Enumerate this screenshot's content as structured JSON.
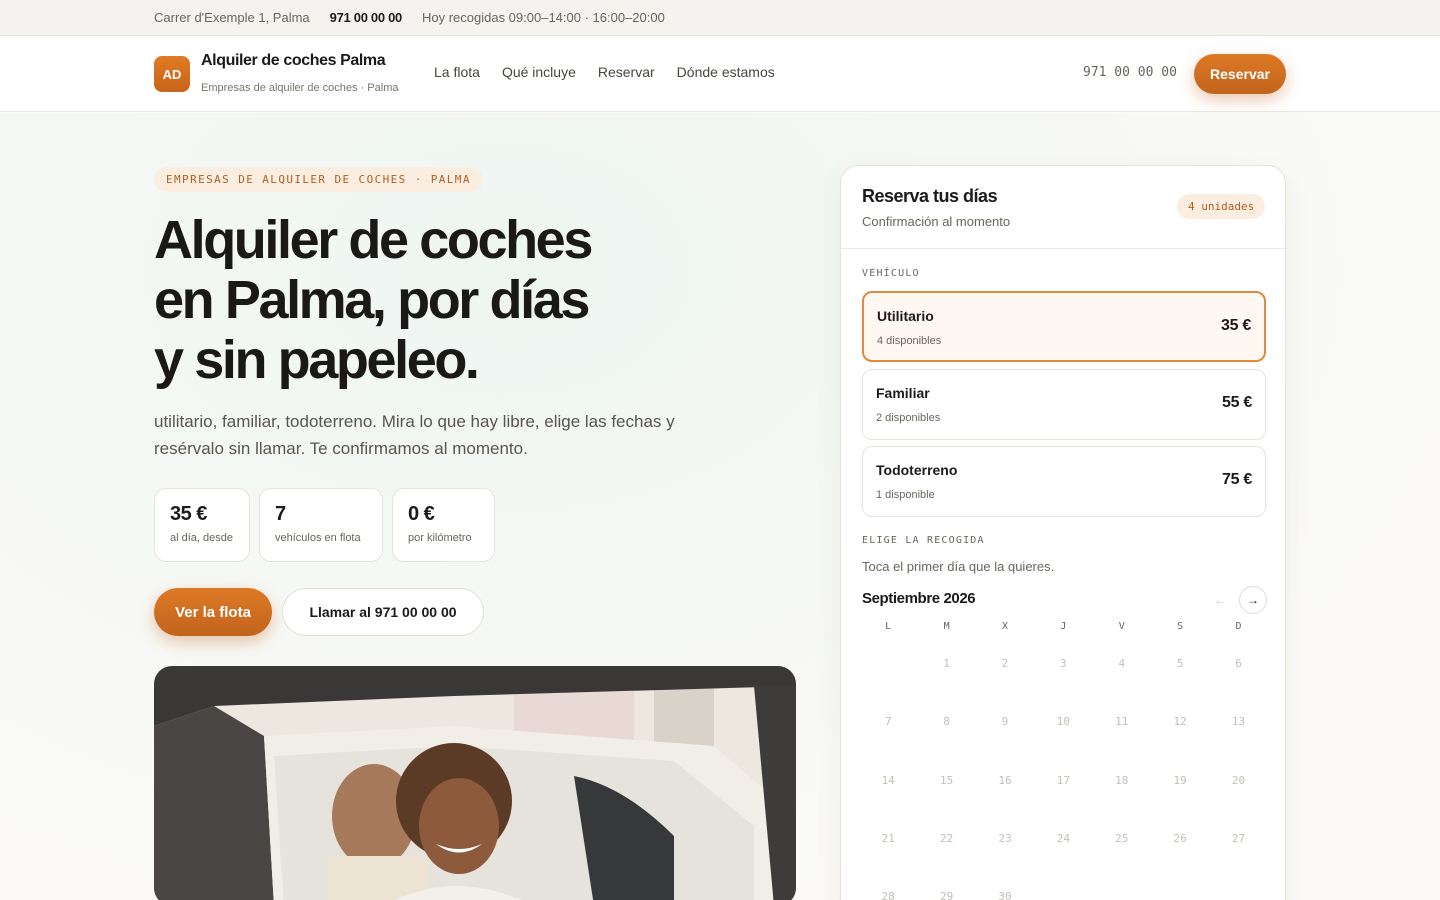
{
  "topbar": {
    "address": "Carrer d'Exemple 1, Palma",
    "phone": "971 00 00 00",
    "hours": "Hoy recogidas 09:00–14:00 · 16:00–20:00"
  },
  "nav": {
    "logo": "AD",
    "brand_name": "Alquiler de coches Palma",
    "brand_sub": "Empresas de alquiler de coches · Palma",
    "menu": [
      "La flota",
      "Qué incluye",
      "Reservar",
      "Dónde estamos"
    ],
    "phone": "971 00 00 00",
    "cta": "Reservar"
  },
  "hero": {
    "eyebrow": "EMPRESAS DE ALQUILER DE COCHES · PALMA",
    "title_lines": [
      "Alquiler de coches",
      "en Palma, por días",
      "y sin papeleo."
    ],
    "text": "utilitario, familiar, todoterreno. Mira lo que hay libre, elige las fechas y resérvalo sin llamar. Te confirmamos al momento.",
    "stats": [
      {
        "value": "35 €",
        "label": "al día, desde"
      },
      {
        "value": "7",
        "label": "vehículos en flota"
      },
      {
        "value": "0 €",
        "label": "por kilómetro"
      }
    ],
    "primary_cta": "Ver la flota",
    "secondary_cta": "Llamar al 971 00 00 00"
  },
  "booking": {
    "title": "Reserva tus días",
    "subtitle": "Confirmación al momento",
    "units_badge": "4 unidades",
    "vehicle_label": "VEHÍCULO",
    "vehicles": [
      {
        "name": "Utilitario",
        "availability": "4 disponibles",
        "price": "35 €",
        "selected": true
      },
      {
        "name": "Familiar",
        "availability": "2 disponibles",
        "price": "55 €",
        "selected": false
      },
      {
        "name": "Todoterreno",
        "availability": "1 disponible",
        "price": "75 €",
        "selected": false
      }
    ],
    "pickup_label": "ELIGE LA RECOGIDA",
    "pickup_hint": "Toca el primer día que la quieres.",
    "month": "Septiembre 2026",
    "prev_icon": "←",
    "next_icon": "→",
    "weekdays": [
      "L",
      "M",
      "X",
      "J",
      "V",
      "S",
      "D"
    ],
    "weeks": [
      [
        "",
        "1",
        "2",
        "3",
        "4",
        "5",
        "6"
      ],
      [
        "7",
        "8",
        "9",
        "10",
        "11",
        "12",
        "13"
      ],
      [
        "14",
        "15",
        "16",
        "17",
        "18",
        "19",
        "20"
      ],
      [
        "21",
        "22",
        "23",
        "24",
        "25",
        "26",
        "27"
      ],
      [
        "28",
        "29",
        "30",
        "",
        "",
        "",
        ""
      ]
    ]
  },
  "colors": {
    "accent": "#d0701f",
    "accent_soft": "#fbeee1",
    "text": "#1c1b19",
    "muted": "#6a655d"
  }
}
